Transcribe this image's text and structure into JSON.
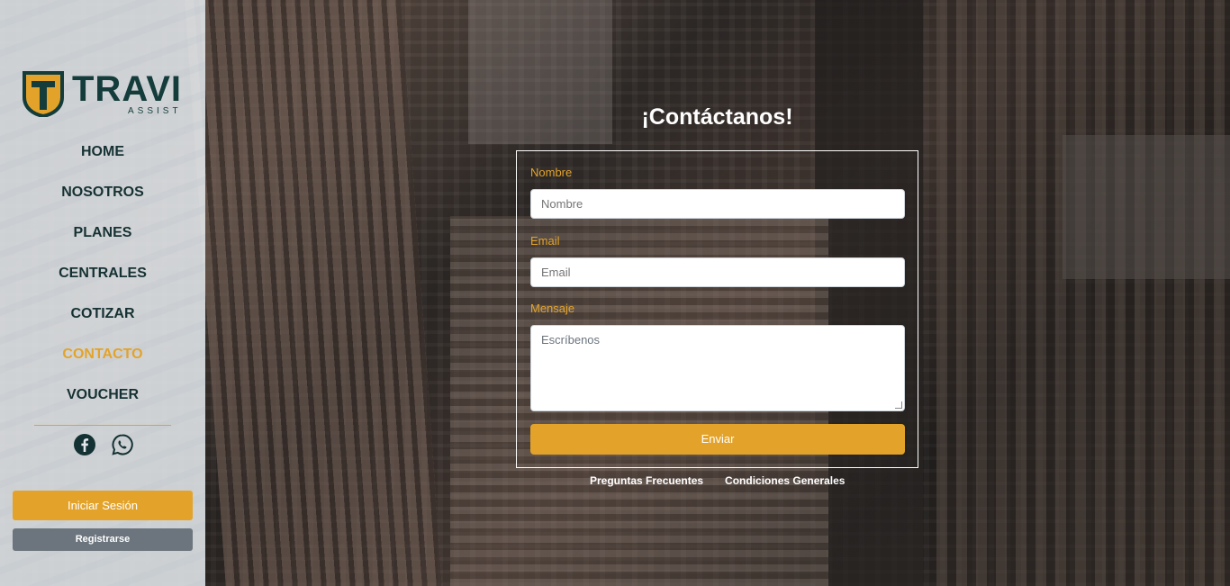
{
  "brand": {
    "name": "TRAVI",
    "tagline": "ASSIST"
  },
  "nav": {
    "items": [
      {
        "label": "HOME"
      },
      {
        "label": "NOSOTROS"
      },
      {
        "label": "PLANES"
      },
      {
        "label": "CENTRALES"
      },
      {
        "label": "COTIZAR"
      },
      {
        "label": "CONTACTO",
        "active": true
      },
      {
        "label": "VOUCHER"
      }
    ]
  },
  "social": {
    "icons": [
      "facebook-icon",
      "whatsapp-icon"
    ]
  },
  "auth": {
    "login_label": "Iniciar Sesión",
    "register_label": "Registrarse"
  },
  "contact": {
    "title": "¡Contáctanos!",
    "name_label": "Nombre",
    "name_placeholder": "Nombre",
    "email_label": "Email",
    "email_placeholder": "Email",
    "message_label": "Mensaje",
    "message_placeholder": "Escríbenos",
    "submit_label": "Enviar"
  },
  "footer": {
    "faq_label": "Preguntas Frecuentes",
    "terms_label": "Condiciones Generales"
  },
  "colors": {
    "accent": "#e3a32a",
    "brand_dark": "#143c3a",
    "secondary_button": "#6c757d"
  }
}
